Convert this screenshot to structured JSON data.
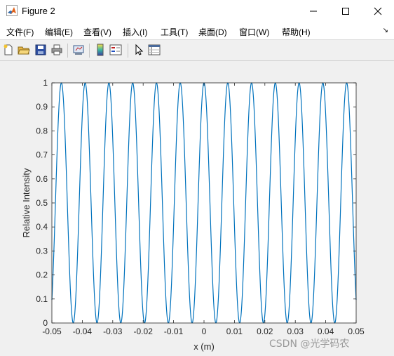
{
  "window": {
    "title": "Figure 2",
    "minimize_icon": "minimize-icon",
    "maximize_icon": "maximize-icon",
    "close_icon": "close-icon"
  },
  "menu": {
    "items": [
      "文件(F)",
      "编辑(E)",
      "查看(V)",
      "插入(I)",
      "工具(T)",
      "桌面(D)",
      "窗口(W)",
      "帮助(H)"
    ]
  },
  "toolbar": {
    "icons": [
      "new-figure-icon",
      "open-file-icon",
      "save-icon",
      "print-icon",
      "link-figure-icon",
      "colorbar-icon",
      "legend-icon",
      "pointer-icon",
      "property-inspector-icon"
    ]
  },
  "chart_data": {
    "type": "line",
    "xlabel": "x (m)",
    "ylabel": "Relative Intensity",
    "xlim": [
      -0.05,
      0.05
    ],
    "ylim": [
      0,
      1
    ],
    "xticks": [
      "-0.05",
      "-0.04",
      "-0.03",
      "-0.02",
      "-0.01",
      "0",
      "0.01",
      "0.02",
      "0.03",
      "0.04",
      "0.05"
    ],
    "yticks": [
      "0",
      "0.1",
      "0.2",
      "0.3",
      "0.4",
      "0.5",
      "0.6",
      "0.7",
      "0.8",
      "0.9",
      "1"
    ],
    "grid": false,
    "series": [
      {
        "function": "cos^2(pi*x/p)",
        "period_m": 0.007813,
        "color": "#0072bd"
      }
    ]
  },
  "watermark": "CSDN @光学码农"
}
